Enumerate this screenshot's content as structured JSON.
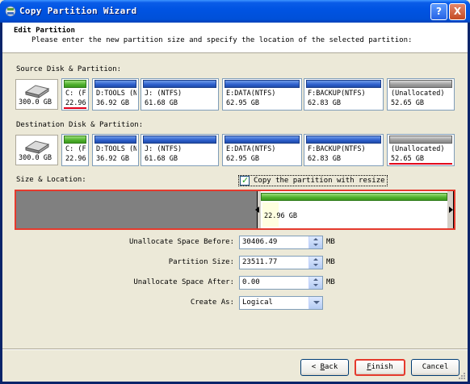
{
  "window": {
    "title": "Copy Partition Wizard",
    "help_glyph": "?",
    "close_glyph": "X"
  },
  "header": {
    "title": "Edit Partition",
    "subtitle": "Please enter the new partition size and specify the location of the selected partition:"
  },
  "source": {
    "label": "Source Disk & Partition:",
    "disk_size": "300.0 GB",
    "partitions": [
      {
        "name": "C: (FA'",
        "size": "22.96",
        "bar": "green"
      },
      {
        "name": "D:TOOLS (NI",
        "size": "36.92 GB",
        "bar": "blue"
      },
      {
        "name": "J: (NTFS)",
        "size": "61.68 GB",
        "bar": "blue"
      },
      {
        "name": "E:DATA(NTFS)",
        "size": "62.95 GB",
        "bar": "blue"
      },
      {
        "name": "F:BACKUP(NTFS)",
        "size": "62.83 GB",
        "bar": "blue"
      },
      {
        "name": "(Unallocated)",
        "size": "52.65 GB",
        "bar": "gray"
      }
    ]
  },
  "destination": {
    "label": "Destination Disk & Partition:",
    "disk_size": "300.0 GB",
    "partitions": [
      {
        "name": "C: (FA'",
        "size": "22.96",
        "bar": "green"
      },
      {
        "name": "D:TOOLS (NI",
        "size": "36.92 GB",
        "bar": "blue"
      },
      {
        "name": "J: (NTFS)",
        "size": "61.68 GB",
        "bar": "blue"
      },
      {
        "name": "E:DATA(NTFS)",
        "size": "62.95 GB",
        "bar": "blue"
      },
      {
        "name": "F:BACKUP(NTFS)",
        "size": "62.83 GB",
        "bar": "blue"
      },
      {
        "name": "(Unallocated)",
        "size": "52.65 GB",
        "bar": "gray"
      }
    ]
  },
  "size_location": {
    "label": "Size & Location:",
    "copy_resize_label": "Copy the partition with resize",
    "copy_resize_checked": true,
    "partition_size_text": "22.96 GB"
  },
  "fields": {
    "unalloc_before_label": "Unallocate Space Before:",
    "unalloc_before_value": "30406.49",
    "partition_size_label": "Partition Size:",
    "partition_size_value": "23511.77",
    "unalloc_after_label": "Unallocate Space After:",
    "unalloc_after_value": "0.00",
    "create_as_label": "Create As:",
    "create_as_value": "Logical",
    "unit": "MB"
  },
  "buttons": {
    "back_prefix": "< ",
    "back_mnemonic": "B",
    "back_rest": "ack",
    "finish_mnemonic": "F",
    "finish_rest": "inish",
    "cancel": "Cancel"
  },
  "colors": {
    "accent_highlight": "#E53A2D",
    "partition_blue": "#2D5FCC",
    "partition_green": "#4EAE2C",
    "unallocated_gray": "#9C9C9C"
  }
}
